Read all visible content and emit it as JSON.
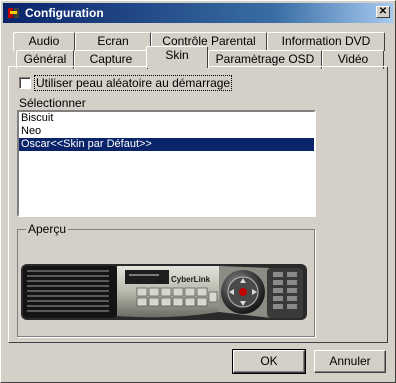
{
  "window": {
    "title": "Configuration",
    "close_glyph": "✕"
  },
  "tabs": {
    "row_back": [
      "Audio",
      "Ecran",
      "Contrôle Parental",
      "Information DVD"
    ],
    "row_front": [
      "Général",
      "Capture",
      "Skin",
      "Paramètrage OSD",
      "Vidéo"
    ],
    "active": "Skin"
  },
  "skin": {
    "random_checkbox_label": "Utiliser peau aléatoire au démarrage",
    "random_checked": false,
    "select_label": "Sélectionner",
    "list": [
      "Biscuit",
      "Neo",
      "Oscar<<Skin par Défaut>>"
    ],
    "selected_index": 2,
    "preview_label": "Aperçu",
    "preview_brand": "CyberLink"
  },
  "buttons": {
    "ok": "OK",
    "cancel": "Annuler"
  },
  "colors": {
    "face": "#d4d0c8",
    "title_start": "#0a246a",
    "selection": "#0a246a"
  }
}
